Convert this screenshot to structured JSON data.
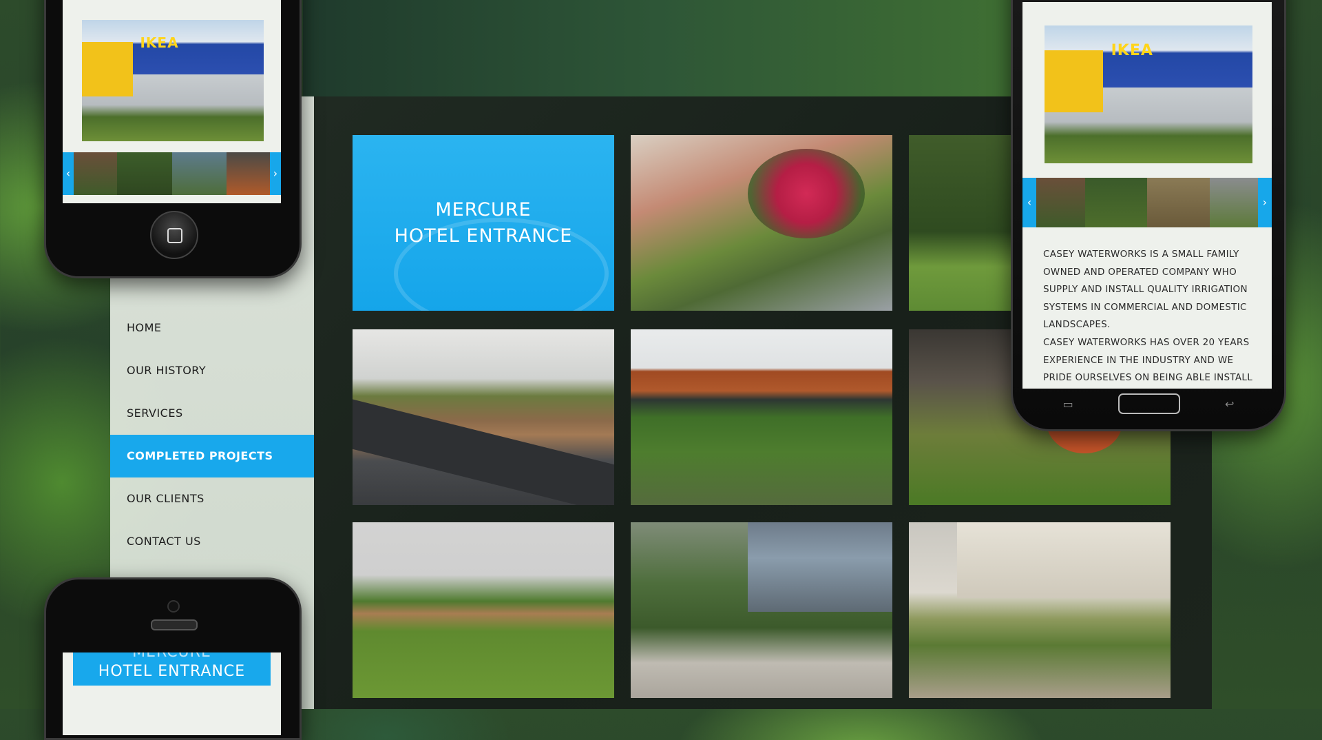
{
  "nav": {
    "items": [
      {
        "label": "HOME"
      },
      {
        "label": "OUR HISTORY"
      },
      {
        "label": "SERVICES"
      },
      {
        "label": "COMPLETED PROJECTS"
      },
      {
        "label": "OUR CLIENTS"
      },
      {
        "label": "CONTACT US"
      }
    ],
    "active_index": 3
  },
  "featured": {
    "line1": "MERCURE",
    "line2": "HOTEL ENTRANCE"
  },
  "phone_left_top": {
    "sign": "IKEA"
  },
  "phone_right": {
    "sign": "IKEA",
    "paragraph1": "CASEY WATERWORKS IS A SMALL FAMILY OWNED AND OPERATED COMPANY WHO SUPPLY AND INSTALL QUALITY IRRIGATION SYSTEMS IN COMMERCIAL AND DOMESTIC LANDSCAPES.",
    "paragraph2": "CASEY WATERWORKS HAS OVER 20 YEARS EXPERIENCE IN THE INDUSTRY AND WE PRIDE OURSELVES ON BEING ABLE INSTALL OUR"
  },
  "phone_left_bottom": {
    "line1": "MERCURE",
    "line2": "HOTEL ENTRANCE"
  },
  "colors": {
    "accent": "#18a8ec",
    "sidebar": "#e8ede6",
    "gallery": "#1c241d"
  },
  "icons": {
    "prev": "chevron-left-icon",
    "next": "chevron-right-icon",
    "home": "home-button-icon",
    "menu": "menu-icon",
    "back": "back-icon"
  }
}
